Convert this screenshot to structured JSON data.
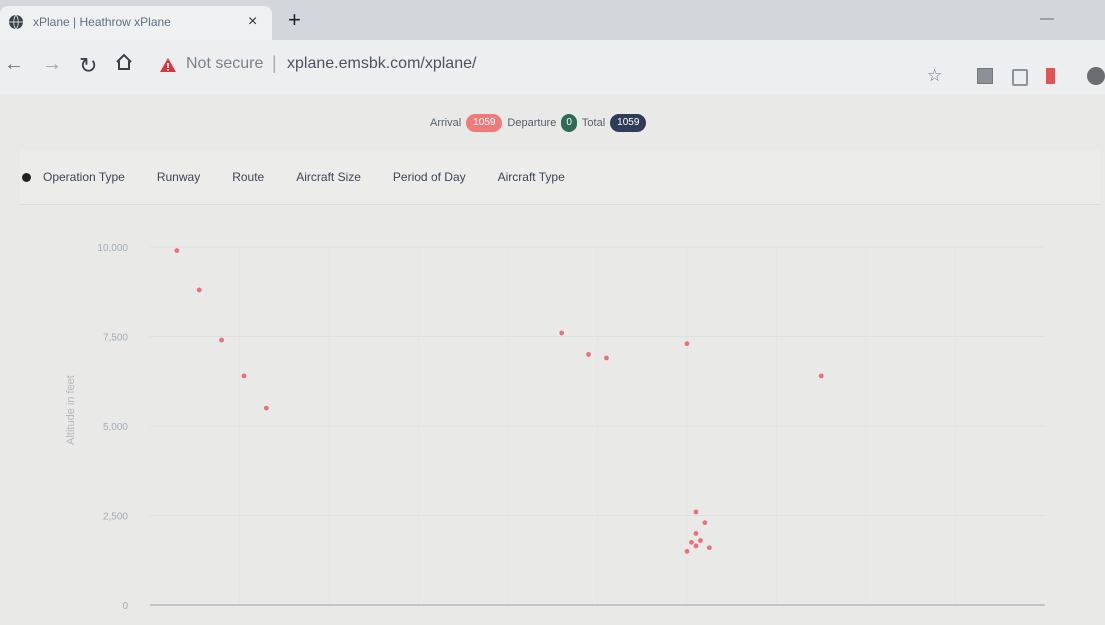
{
  "browser": {
    "tab_title": "xPlane | Heathrow xPlane",
    "tab_close": "×",
    "new_tab": "+",
    "not_secure": "Not secure",
    "separator": "|",
    "url": "xplane.emsbk.com/xplane/",
    "icons": [
      "back-arrow-icon",
      "forward-arrow-icon",
      "reload-icon",
      "home-icon",
      "warning-icon",
      "star-icon",
      "extension-icon",
      "bookmark-icon",
      "profile-avatar-icon"
    ]
  },
  "counters": {
    "arrival_label": "Arrival",
    "arrival_value": "1059",
    "departure_label": "Departure",
    "departure_value": "0",
    "total_label": "Total",
    "total_value": "1059"
  },
  "filters": {
    "selected": "Operation Type",
    "options": [
      "Operation Type",
      "Runway",
      "Route",
      "Aircraft Size",
      "Period of Day",
      "Aircraft Type"
    ]
  },
  "chart_data": {
    "type": "scatter",
    "ylabel": "Altitude in feet",
    "yticks": [
      "10,000",
      "7,500",
      "5,000",
      "2,500",
      "0"
    ],
    "ylim": [
      0,
      10000
    ],
    "colors": {
      "arrival": "#ef4f5f",
      "departure": "#2f6b58"
    },
    "series": [
      {
        "values": [
          [
            0.3,
            9900
          ],
          [
            0.55,
            8800
          ],
          [
            0.8,
            7400
          ],
          [
            1.05,
            6400
          ],
          [
            1.3,
            5500
          ],
          [
            4.6,
            7600
          ],
          [
            4.9,
            7000
          ],
          [
            5.1,
            6900
          ],
          [
            6.0,
            7300
          ],
          [
            7.5,
            6400
          ],
          [
            6.1,
            2000
          ],
          [
            6.15,
            1800
          ],
          [
            6.2,
            2300
          ],
          [
            6.0,
            1500
          ],
          [
            6.05,
            1750
          ],
          [
            6.1,
            1650
          ],
          [
            6.25,
            1600
          ],
          [
            6.1,
            2600
          ]
        ]
      }
    ]
  }
}
